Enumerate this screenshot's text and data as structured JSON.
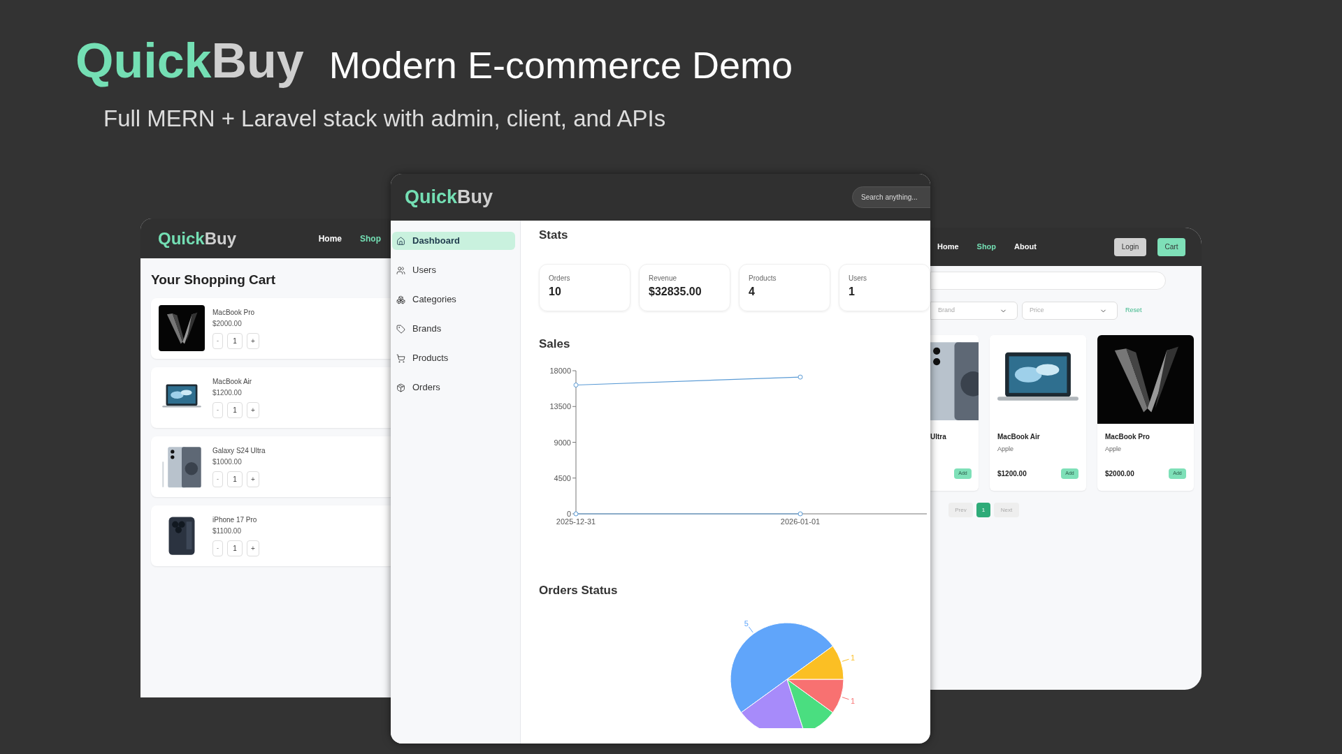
{
  "banner": {
    "logo": {
      "first": "Quick",
      "second": "Buy"
    },
    "title": "Modern E-commerce Demo",
    "subtitle": "Full MERN + Laravel stack with admin, client, and APIs"
  },
  "cart_window": {
    "logo": {
      "first": "Quick",
      "second": "Buy"
    },
    "nav": [
      {
        "label": "Home",
        "selected": false
      },
      {
        "label": "Shop",
        "selected": true
      }
    ],
    "title": "Your Shopping Cart",
    "items": [
      {
        "name": "MacBook Pro",
        "price": "$2000.00",
        "minus": "-",
        "qty": "1",
        "plus": "+"
      },
      {
        "name": "MacBook Air",
        "price": "$1200.00",
        "minus": "-",
        "qty": "1",
        "plus": "+"
      },
      {
        "name": "Galaxy S24 Ultra",
        "price": "$1000.00",
        "minus": "-",
        "qty": "1",
        "plus": "+"
      },
      {
        "name": "iPhone 17 Pro",
        "price": "$1100.00",
        "minus": "-",
        "qty": "1",
        "plus": "+"
      }
    ]
  },
  "admin_window": {
    "logo": {
      "first": "Quick",
      "second": "Buy"
    },
    "search": {
      "placeholder": "Search anything..."
    },
    "sidebar": {
      "items": [
        {
          "label": "Dashboard",
          "selected": true
        },
        {
          "label": "Users",
          "selected": false
        },
        {
          "label": "Categories",
          "selected": false
        },
        {
          "label": "Brands",
          "selected": false
        },
        {
          "label": "Products",
          "selected": false
        },
        {
          "label": "Orders",
          "selected": false
        }
      ]
    },
    "stats_title": "Stats",
    "stats": [
      {
        "label": "Orders",
        "value": "10"
      },
      {
        "label": "Revenue",
        "value": "$32835.00"
      },
      {
        "label": "Products",
        "value": "4"
      },
      {
        "label": "Users",
        "value": "1"
      }
    ],
    "sales": {
      "chart_data": {
        "type": "line",
        "title": "Sales",
        "x": [
          "2025-12-31",
          "2026-01-01"
        ],
        "ylim": [
          0,
          18000
        ],
        "yticks": [
          0,
          4500,
          9000,
          13500,
          18000
        ],
        "series": [
          {
            "color": "#5b9bd5",
            "marker": true,
            "values": [
              16200,
              17200
            ]
          },
          {
            "color": "#5b9bd5",
            "marker": true,
            "values": [
              0,
              0
            ]
          }
        ]
      }
    },
    "orders_status": {
      "chart_data": {
        "type": "pie",
        "title": "Orders Status",
        "values": [
          5,
          2,
          1,
          1,
          1
        ],
        "colors": [
          "#60a5fa",
          "#a78bfa",
          "#4ade80",
          "#f87171",
          "#fbbf24"
        ],
        "value_labels": [
          "5",
          null,
          null,
          "1",
          "1"
        ]
      }
    }
  },
  "shop_window": {
    "nav": [
      {
        "label": "Home",
        "selected": false
      },
      {
        "label": "Shop",
        "selected": true
      },
      {
        "label": "About",
        "selected": false
      }
    ],
    "login": "Login",
    "cart": "Cart",
    "filters": [
      {
        "placeholder": "Brand"
      },
      {
        "placeholder": "Price"
      }
    ],
    "reset": "Reset",
    "products": [
      {
        "name": "Ultra",
        "add": "Add"
      },
      {
        "name": "MacBook Air",
        "brand": "Apple",
        "price": "$1200.00",
        "add": "Add"
      },
      {
        "name": "MacBook Pro",
        "brand": "Apple",
        "price": "$2000.00",
        "add": "Add"
      }
    ],
    "pagination": {
      "prev": "Prev",
      "pages": [
        {
          "label": "1",
          "selected": true
        }
      ],
      "next": "Next"
    }
  }
}
